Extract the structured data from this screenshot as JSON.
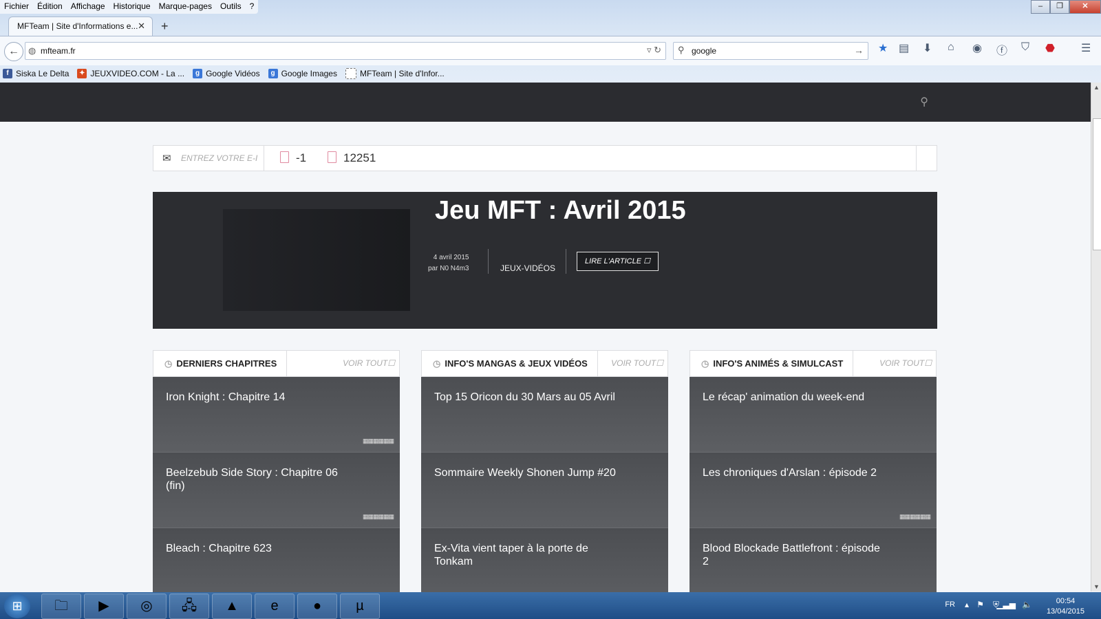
{
  "menubar": [
    "Fichier",
    "Édition",
    "Affichage",
    "Historique",
    "Marque-pages",
    "Outils",
    "?"
  ],
  "tab": {
    "title": "MFTeam | Site d'Informations e...",
    "close": "✕",
    "new": "+"
  },
  "nav": {
    "url": "mfteam.fr",
    "search_value": "google"
  },
  "bookmarks": [
    {
      "label": "Siska Le Delta",
      "icon": "facebook-icon",
      "color": "#3b5998"
    },
    {
      "label": "JEUXVIDEO.COM - La ...",
      "icon": "gamepad-icon",
      "color": "#d94a1e"
    },
    {
      "label": "Google Vidéos",
      "icon": "google-icon",
      "color": "#3a77d8"
    },
    {
      "label": "Google Images",
      "icon": "google-icon",
      "color": "#3a77d8"
    },
    {
      "label": "MFTeam | Site d'Infor...",
      "icon": "page-icon",
      "color": "#ffffff"
    }
  ],
  "infobar": {
    "email_placeholder": "ENTREZ VOTRE E-I",
    "count1": "-1",
    "count2": "12251"
  },
  "hero": {
    "title": "Jeu MFT : Avril 2015",
    "date": "4 avril 2015",
    "author": "par N0 N4m3",
    "category": "JEUX-VIDÉOS",
    "button": "LIRE L'ARTICLE"
  },
  "columns": [
    {
      "title": "DERNIERS CHAPITRES",
      "voir": "VOIR TOUT",
      "cards": [
        {
          "title": "Iron Knight : Chapitre 14",
          "bars": true
        },
        {
          "title": "Beelzebub Side Story : Chapitre 06 (fin)",
          "bars": true
        },
        {
          "title": "Bleach : Chapitre 623",
          "bars": false
        }
      ]
    },
    {
      "title": "INFO'S MANGAS & JEUX VIDÉOS",
      "voir": "VOIR TOUT",
      "cards": [
        {
          "title": "Top 15 Oricon du 30 Mars au 05 Avril",
          "bars": false
        },
        {
          "title": "Sommaire Weekly Shonen Jump #20",
          "bars": false
        },
        {
          "title": "Ex-Vita vient taper à la porte de Tonkam",
          "bars": false
        }
      ]
    },
    {
      "title": "INFO'S ANIMÉS & SIMULCAST",
      "voir": "VOIR TOUT",
      "cards": [
        {
          "title": "Le récap' animation du week-end",
          "bars": false
        },
        {
          "title": "Les chroniques d'Arslan : épisode 2",
          "bars": true
        },
        {
          "title": "Blood Blockade Battlefront : épisode 2",
          "bars": false
        }
      ]
    }
  ],
  "taskbar": {
    "apps": [
      "explorer-icon",
      "media-player-icon",
      "chrome-icon",
      "network-icon",
      "vlc-icon",
      "ie-icon",
      "firefox-icon",
      "utorrent-icon"
    ],
    "lang": "FR",
    "time": "00:54",
    "date": "13/04/2015"
  }
}
